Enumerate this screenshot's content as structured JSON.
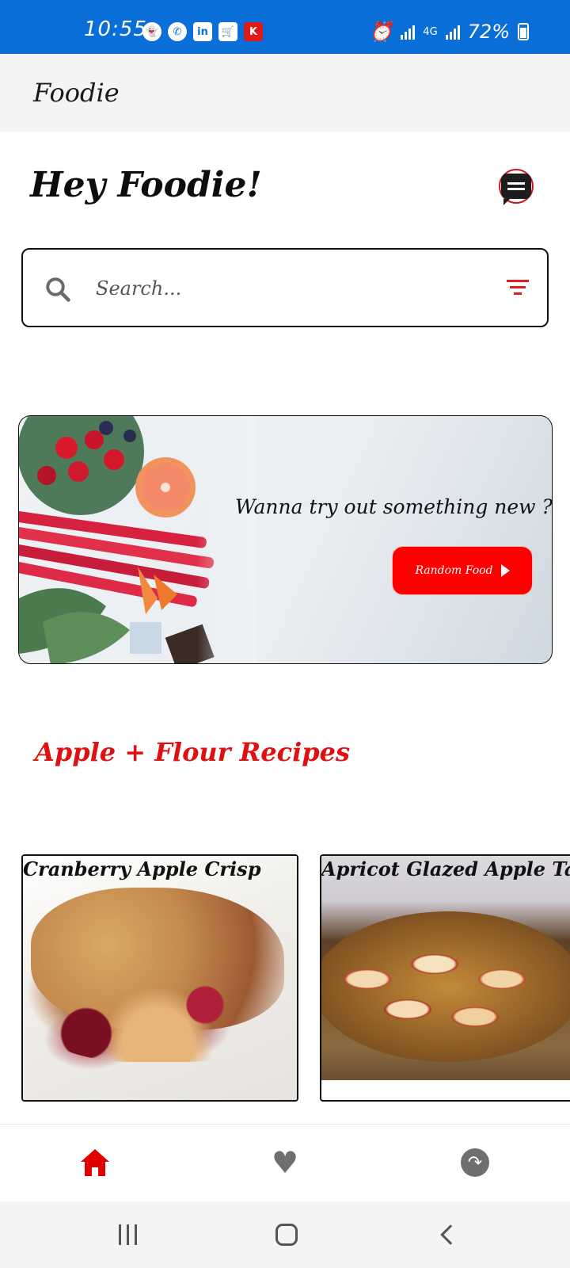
{
  "status_bar": {
    "time": "10:55",
    "battery": "72%",
    "network": "4G"
  },
  "app_bar": {
    "title": "Foodie"
  },
  "greeting": "Hey Foodie!",
  "search": {
    "placeholder": "Search..."
  },
  "banner": {
    "text": "Wanna try out something new ?",
    "button_label": "Random Food"
  },
  "section": {
    "title": "Apple + Flour Recipes"
  },
  "recipes": [
    {
      "title": "Cranberry Apple Crisp"
    },
    {
      "title": "Apricot Glazed Apple Tart"
    }
  ],
  "colors": {
    "status_bar": "#0a6ed8",
    "accent": "#e01010",
    "button": "#ff0000",
    "inactive_icon": "#6f6f6f"
  },
  "bottom_nav": {
    "items": [
      {
        "icon": "home-icon",
        "active": true
      },
      {
        "icon": "heart-icon",
        "active": false
      },
      {
        "icon": "random-icon",
        "active": false
      }
    ]
  }
}
